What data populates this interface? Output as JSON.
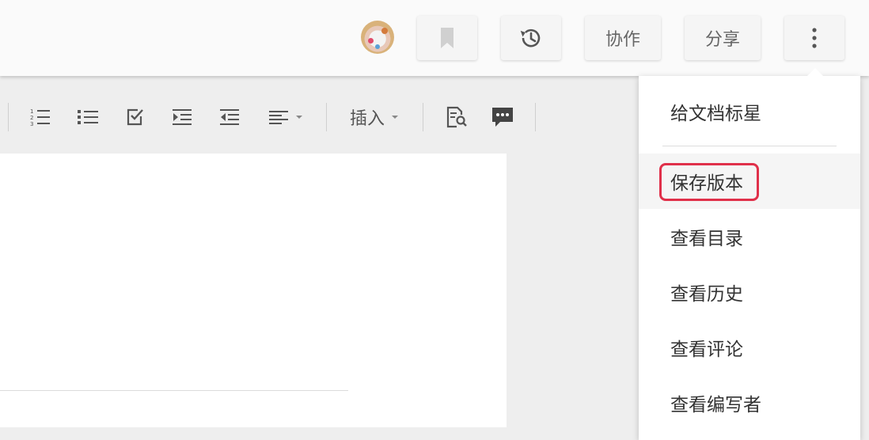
{
  "header": {
    "collaborate_label": "协作",
    "share_label": "分享"
  },
  "toolbar": {
    "insert_label": "插入"
  },
  "menu": {
    "items": [
      {
        "label": "给文档标星"
      },
      {
        "label": "保存版本"
      },
      {
        "label": "查看目录"
      },
      {
        "label": "查看历史"
      },
      {
        "label": "查看评论"
      },
      {
        "label": "查看编写者"
      }
    ]
  },
  "colors": {
    "highlight": "#e0304a",
    "icon": "#555555",
    "menu_active_bg": "#f5f5f5"
  }
}
